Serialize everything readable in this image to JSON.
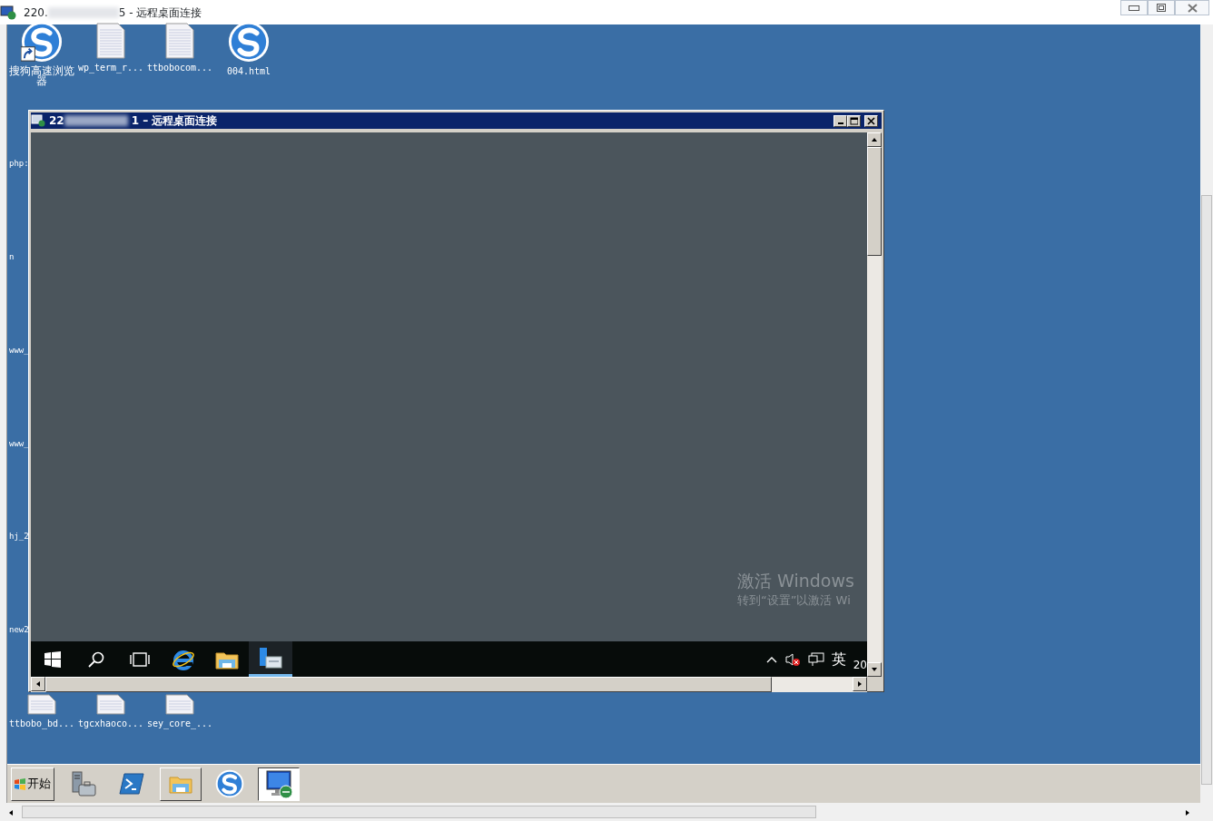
{
  "window": {
    "title_start": "220.",
    "title_end": "5 - 远程桌面连接"
  },
  "desktop_icons": [
    {
      "label": "搜狗高速浏览器",
      "kind": "swirl",
      "shortcut": true
    },
    {
      "label": "wp_term_r...",
      "kind": "document",
      "shortcut": false
    },
    {
      "label": "ttbobocom...",
      "kind": "document",
      "shortcut": false
    },
    {
      "label": "004.html",
      "kind": "swirl",
      "shortcut": false
    }
  ],
  "left_labels": [
    "php:",
    "n",
    "www_",
    "www_",
    "hj_2",
    "new2"
  ],
  "bottom_icons": [
    {
      "label": "ttbobo_bd...",
      "kind": "document"
    },
    {
      "label": "tgcxhaoco...",
      "kind": "document"
    },
    {
      "label": "sey_core_...",
      "kind": "document"
    }
  ],
  "remote_window": {
    "title_start": "22",
    "title_end": "1 – 远程桌面连接",
    "watermark_title": "激活 Windows",
    "watermark_text": "转到“设置”以激活 Wi",
    "taskbar_apps": [
      {
        "kind": "start",
        "selected": false
      },
      {
        "kind": "search",
        "selected": false
      },
      {
        "kind": "taskview",
        "selected": false
      },
      {
        "kind": "ie",
        "selected": false
      },
      {
        "kind": "folder",
        "selected": false
      },
      {
        "kind": "server",
        "selected": true
      }
    ],
    "ime": "英",
    "clock": "20"
  },
  "taskbar": {
    "start_label": "开始",
    "apps": [
      {
        "kind": "server",
        "open": false,
        "selected": false
      },
      {
        "kind": "powershell",
        "open": false,
        "selected": false
      },
      {
        "kind": "folder",
        "open": true,
        "selected": false
      },
      {
        "kind": "swirl",
        "open": false,
        "selected": false
      },
      {
        "kind": "monitor",
        "open": true,
        "selected": true
      }
    ]
  }
}
